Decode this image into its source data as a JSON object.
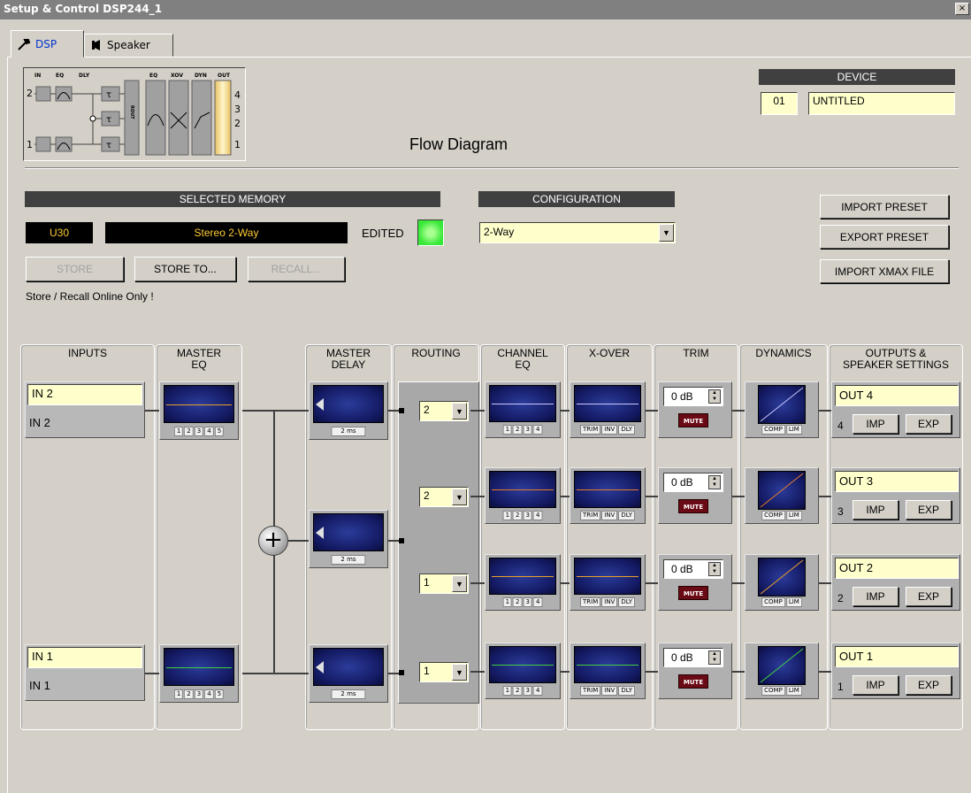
{
  "window": {
    "title": "Setup & Control DSP244_1",
    "close_label": "×"
  },
  "tabs": [
    {
      "label": "DSP",
      "icon": "wrench-icon",
      "active": true
    },
    {
      "label": "Speaker",
      "icon": "speaker-icon",
      "active": false
    }
  ],
  "flow_thumb": {
    "labels": {
      "in": "IN",
      "eq": "EQ",
      "dly": "DLY",
      "eq2": "EQ",
      "xov": "XOV",
      "dyn": "DYN",
      "out": "OUT",
      "rout": "ROUT"
    },
    "in_numbers": [
      "2",
      "1"
    ],
    "out_numbers": [
      "4",
      "3",
      "2",
      "1"
    ]
  },
  "flow_title": "Flow Diagram",
  "device": {
    "header": "DEVICE",
    "id": "01",
    "name": "UNTITLED"
  },
  "memory": {
    "header": "SELECTED MEMORY",
    "slot": "U30",
    "name": "Stereo 2-Way",
    "edited_label": "EDITED",
    "store_label": "STORE",
    "store_to_label": "STORE TO...",
    "recall_label": "RECALL...",
    "note": "Store / Recall Online Only !"
  },
  "configuration": {
    "header": "CONFIGURATION",
    "value": "2-Way"
  },
  "preset_buttons": {
    "import": "IMPORT PRESET",
    "export": "EXPORT PRESET",
    "import_xmax": "IMPORT XMAX FILE"
  },
  "columns": {
    "inputs": "INPUTS",
    "master_eq": [
      "MASTER",
      "EQ"
    ],
    "master_delay": [
      "MASTER",
      "DELAY"
    ],
    "routing": "ROUTING",
    "channel_eq": [
      "CHANNEL",
      "EQ"
    ],
    "xover": "X-OVER",
    "trim": "TRIM",
    "dynamics": "DYNAMICS",
    "outputs": [
      "OUTPUTS &",
      "SPEAKER SETTINGS"
    ]
  },
  "inputs": [
    {
      "name": "IN 2",
      "label": "IN 2"
    },
    {
      "name": "IN 1",
      "label": "IN 1"
    }
  ],
  "master_eq_bands": [
    "1",
    "2",
    "3",
    "4",
    "5"
  ],
  "delay_label": "2 ms",
  "channel_eq_bands": [
    "1",
    "2",
    "3",
    "4"
  ],
  "xover_buttons": [
    "TRIM",
    "INV",
    "DLY"
  ],
  "dynamics_buttons": [
    "COMP",
    "LIM"
  ],
  "mute_label": "MUTE",
  "imp_label": "IMP",
  "exp_label": "EXP",
  "plus_symbol": "+",
  "channels": [
    {
      "routing": "2",
      "trim": "0 dB",
      "out_name": "OUT 4",
      "out_num": "4",
      "color": "#c8c8ff"
    },
    {
      "routing": "2",
      "trim": "0 dB",
      "out_name": "OUT 3",
      "out_num": "3",
      "color": "#e8782a"
    },
    {
      "routing": "1",
      "trim": "0 dB",
      "out_name": "OUT 2",
      "out_num": "2",
      "color": "#e8a02a"
    },
    {
      "routing": "1",
      "trim": "0 dB",
      "out_name": "OUT 1",
      "out_num": "1",
      "color": "#40d040"
    }
  ],
  "colors": {
    "in2_trace": "#e8a02a",
    "in1_trace": "#40d040",
    "led_on": "#38e838"
  }
}
